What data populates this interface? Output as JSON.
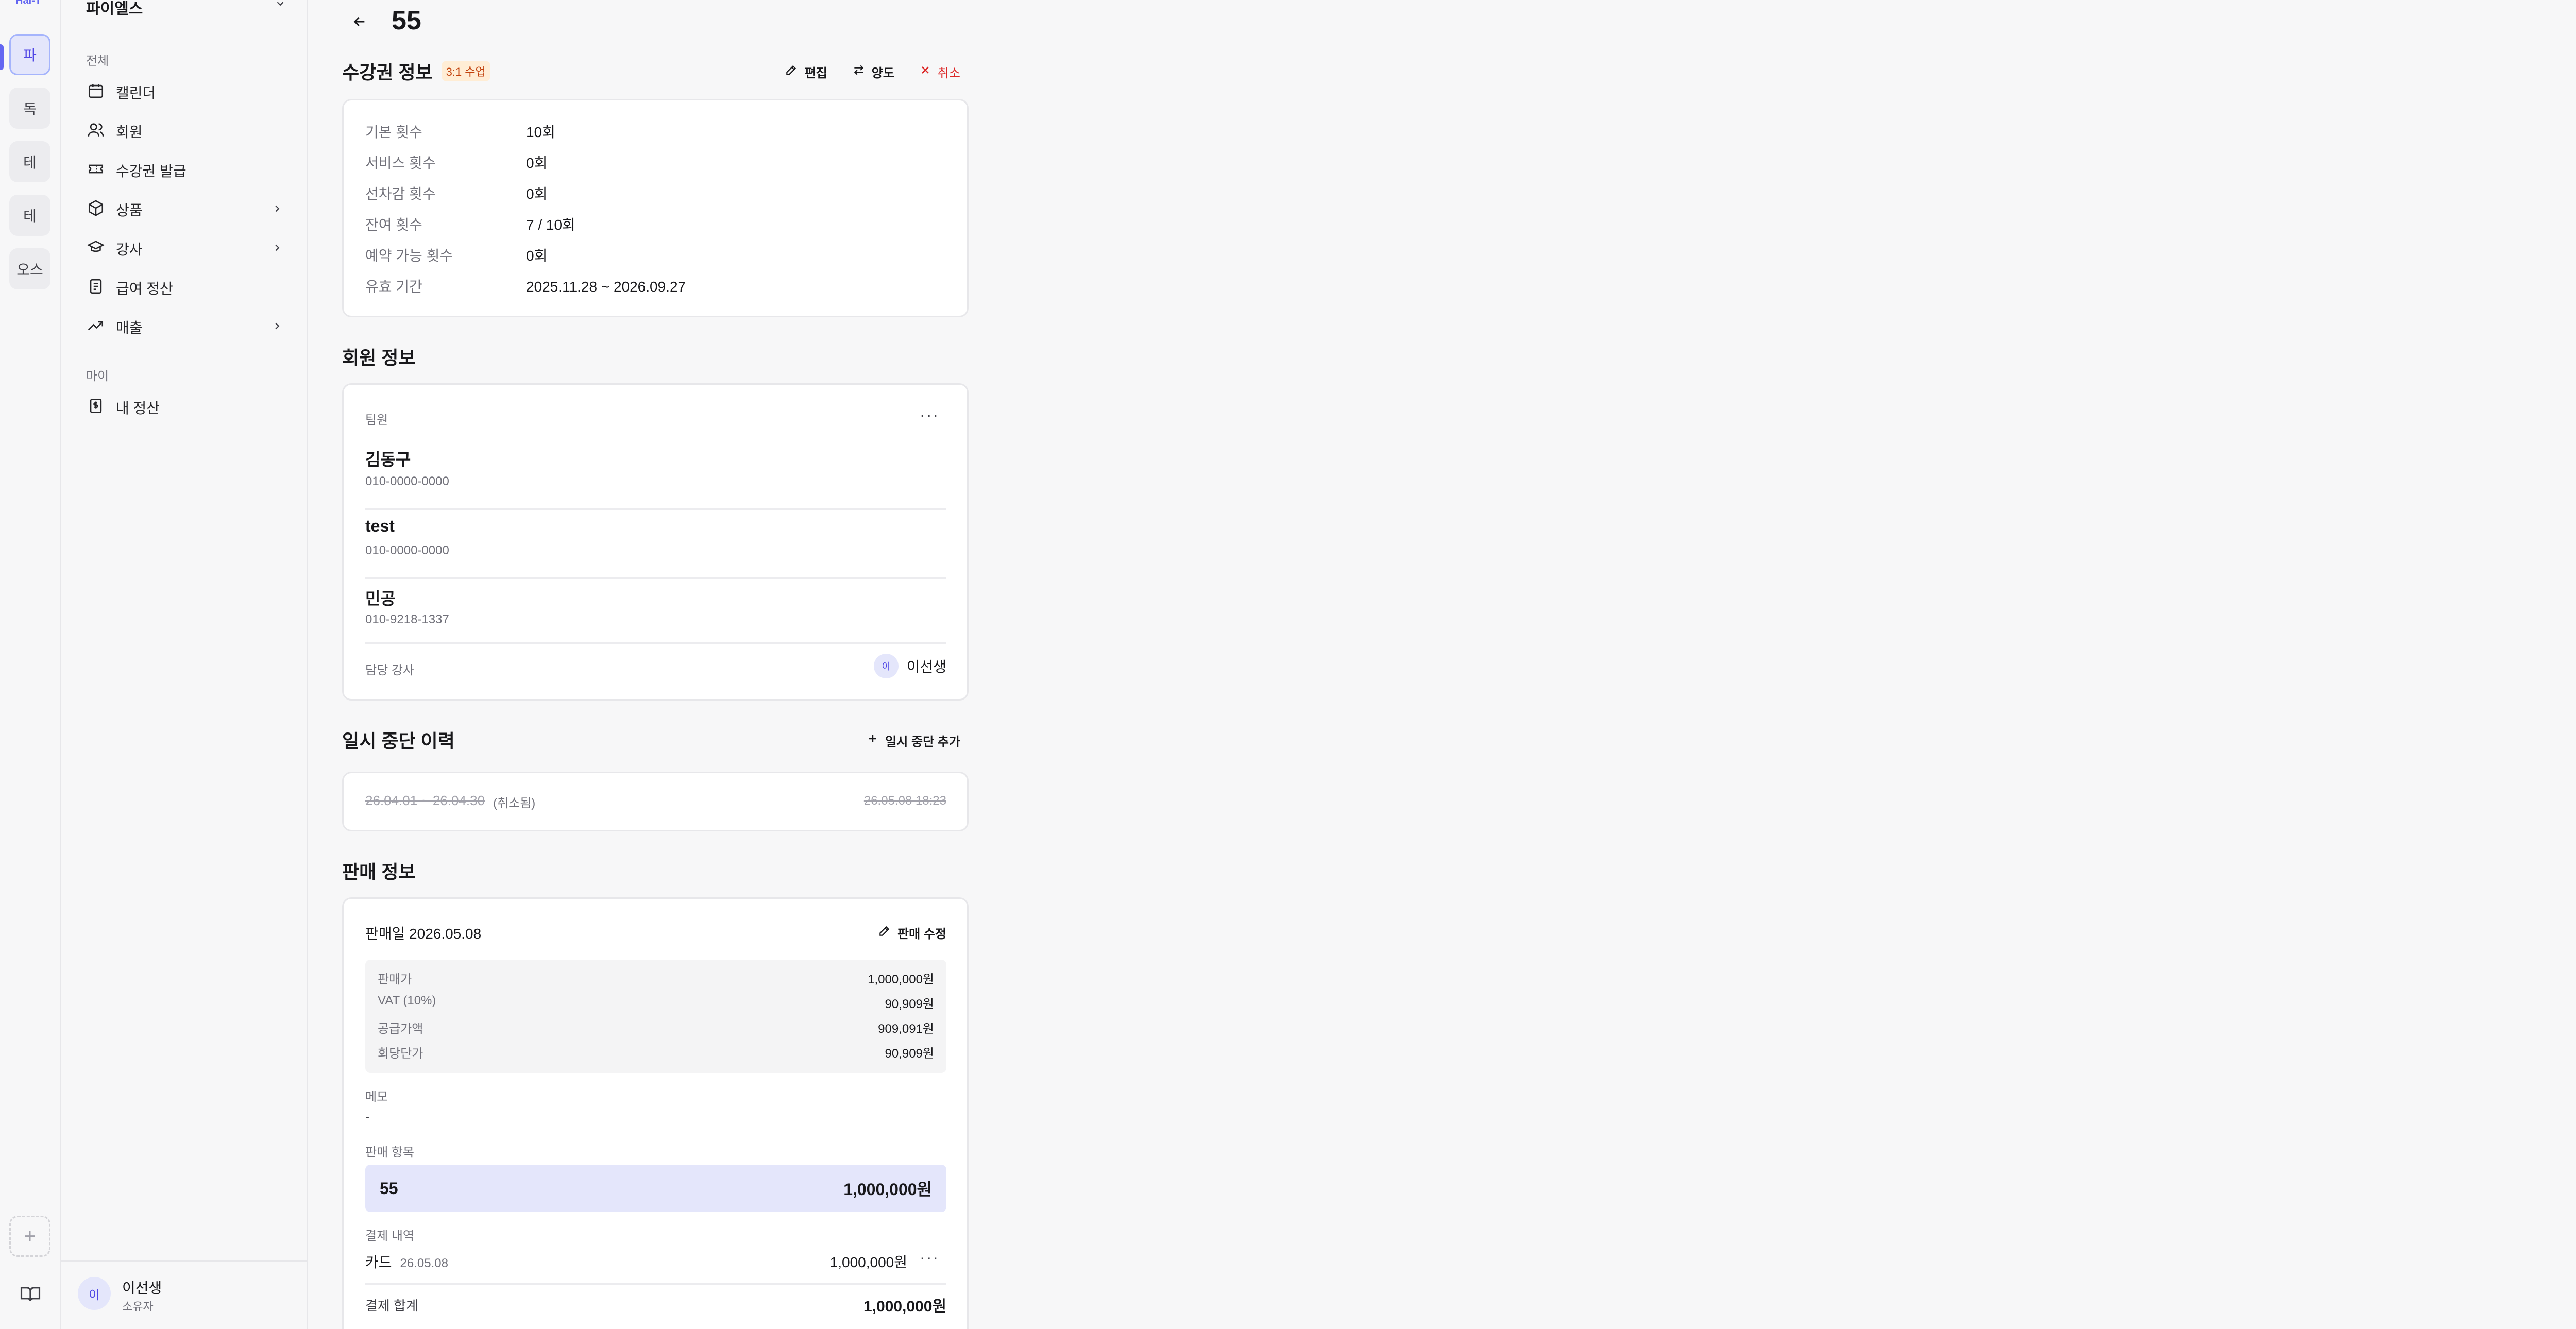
{
  "rail": {
    "logo": "Hal-T",
    "workspaces": [
      {
        "label": "파",
        "active": true
      },
      {
        "label": "독",
        "active": false
      },
      {
        "label": "테",
        "active": false
      },
      {
        "label": "테",
        "active": false
      },
      {
        "label": "오스",
        "active": false
      }
    ],
    "add_icon": "plus-icon",
    "docs_icon": "book-icon"
  },
  "sidebar": {
    "workspace_name": "파이엘스",
    "section_all": "전체",
    "items": [
      {
        "label": "캘린더",
        "icon": "calendar-icon",
        "expandable": false
      },
      {
        "label": "회원",
        "icon": "users-icon",
        "expandable": false
      },
      {
        "label": "수강권 발급",
        "icon": "ticket-icon",
        "expandable": false
      },
      {
        "label": "상품",
        "icon": "package-icon",
        "expandable": true
      },
      {
        "label": "강사",
        "icon": "graduation-cap-icon",
        "expandable": true
      },
      {
        "label": "급여 정산",
        "icon": "receipt-icon",
        "expandable": false
      },
      {
        "label": "매출",
        "icon": "trending-up-icon",
        "expandable": true
      }
    ],
    "section_my": "마이",
    "my_items": [
      {
        "label": "내 정산",
        "icon": "dollar-receipt-icon"
      }
    ],
    "user": {
      "avatar": "이",
      "name": "이선생",
      "role": "소유자"
    }
  },
  "page": {
    "title": "55"
  },
  "pass_info": {
    "title": "수강권 정보",
    "tag": "3:1 수업",
    "actions": {
      "edit": "편집",
      "transfer": "양도",
      "cancel": "취소"
    },
    "rows": [
      {
        "k": "기본 횟수",
        "v": "10회"
      },
      {
        "k": "서비스 횟수",
        "v": "0회"
      },
      {
        "k": "선차감 횟수",
        "v": "0회"
      },
      {
        "k": "잔여 횟수",
        "v": "7 / 10회"
      },
      {
        "k": "예약 가능 횟수",
        "v": "0회"
      },
      {
        "k": "유효 기간",
        "v": "2025.11.28 ~ 2026.09.27"
      }
    ]
  },
  "member_info": {
    "title": "회원 정보",
    "team_label": "팀원",
    "members": [
      {
        "name": "김동구",
        "phone": "010-0000-0000"
      },
      {
        "name": "test",
        "phone": "010-0000-0000"
      },
      {
        "name": "민공",
        "phone": "010-9218-1337"
      }
    ],
    "instructor_label": "담당 강사",
    "instructor_avatar": "이",
    "instructor_name": "이선생"
  },
  "pause_history": {
    "title": "일시 중단 이력",
    "add_label": "일시 중단 추가",
    "entry_range": "26.04.01 ~ 26.04.30",
    "entry_status": "(취소됨)",
    "entry_time": "26.05.08 18:23"
  },
  "sale_info": {
    "title": "판매 정보",
    "sale_date": "판매일 2026.05.08",
    "edit_label": "판매 수정",
    "prices": [
      {
        "k": "판매가",
        "v": "1,000,000원"
      },
      {
        "k": "VAT (10%)",
        "v": "90,909원"
      },
      {
        "k": "공급가액",
        "v": "909,091원"
      },
      {
        "k": "회당단가",
        "v": "90,909원"
      }
    ],
    "memo_label": "메모",
    "memo_value": "-",
    "items_label": "판매 항목",
    "item_name": "55",
    "item_price": "1,000,000원",
    "payments_label": "결제 내역",
    "payment_method": "카드",
    "payment_date": "26.05.08",
    "payment_amount": "1,000,000원",
    "total_label": "결제 합계",
    "total_value": "1,000,000원"
  }
}
